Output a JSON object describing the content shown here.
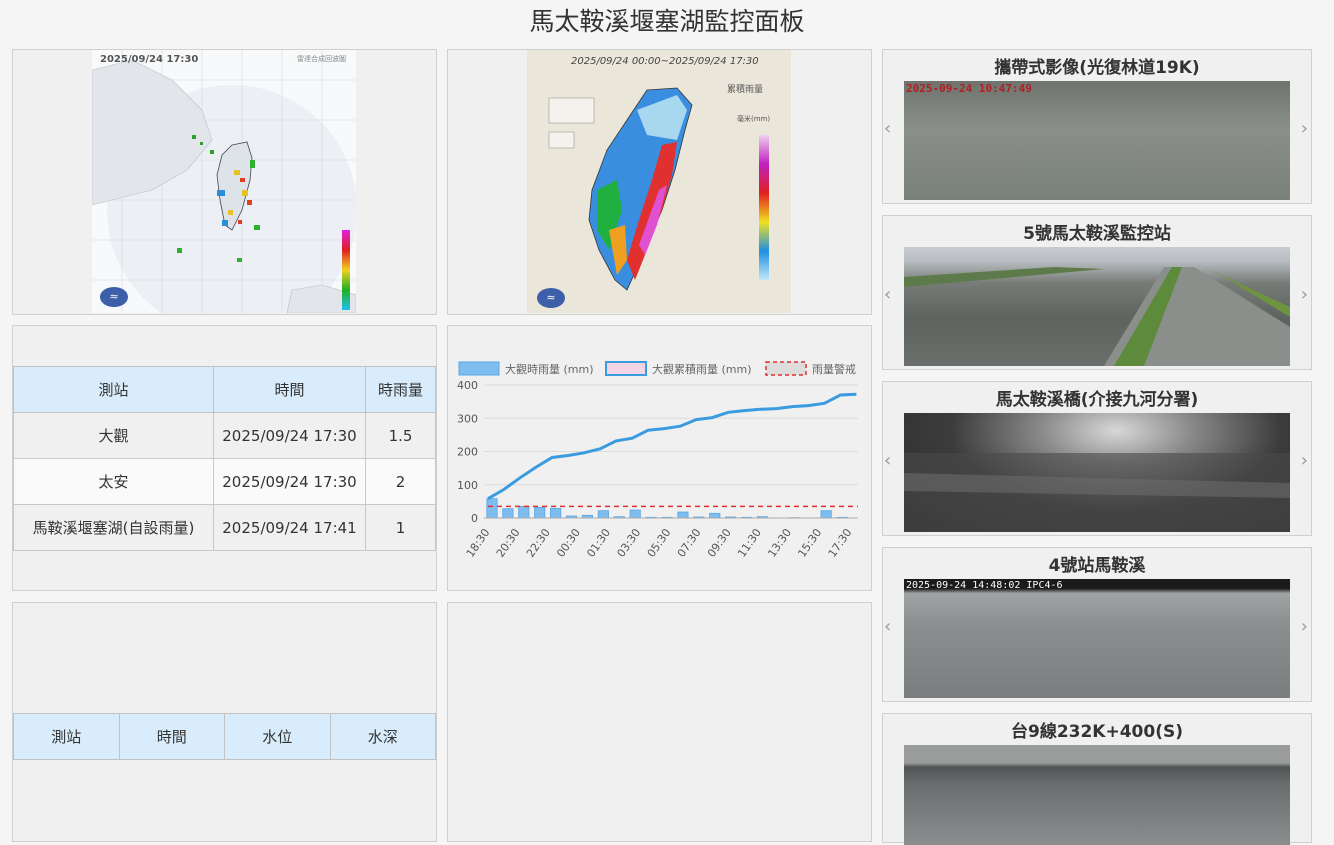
{
  "page": {
    "title": "馬太鞍溪堰塞湖監控面板"
  },
  "radar_image": {
    "timestamp": "2025/09/24  17:30",
    "caption": "雷達合成回波圖"
  },
  "accumulated_image": {
    "range": "2025/09/24 00:00~2025/09/24 17:30",
    "caption": "累積雨量",
    "unit": "毫米(mm)"
  },
  "rain_table": {
    "headers": [
      "測站",
      "時間",
      "時雨量"
    ],
    "rows": [
      {
        "station": "大觀",
        "time": "2025/09/24 17:30",
        "value": "1.5"
      },
      {
        "station": "太安",
        "time": "2025/09/24 17:30",
        "value": "2"
      },
      {
        "station": "馬鞍溪堰塞湖(自設雨量)",
        "time": "2025/09/24 17:41",
        "value": "1"
      }
    ]
  },
  "water_table": {
    "headers": [
      "測站",
      "時間",
      "水位",
      "水深"
    ]
  },
  "chart_data": {
    "type": "bar",
    "legend": [
      "大觀時雨量 (mm)",
      "大觀累積雨量 (mm)",
      "雨量警戒"
    ],
    "legend_position": "top",
    "ylim": [
      0,
      400
    ],
    "yticks": [
      "400",
      "300",
      "200",
      "100",
      "0"
    ],
    "xtick_labels": [
      "18:30",
      "20:30",
      "22:30",
      "00:30",
      "01:30",
      "03:30",
      "05:30",
      "07:30",
      "09:30",
      "11:30",
      "13:30",
      "15:30",
      "17:30"
    ],
    "grid": true,
    "hourly_bars": [
      58,
      28,
      35,
      32,
      29,
      6,
      8,
      22,
      4,
      24,
      2,
      2,
      18,
      3,
      14,
      3,
      2,
      4,
      0,
      1,
      0,
      22,
      2
    ],
    "cumulative_line": [
      58,
      86,
      121,
      153,
      182,
      188,
      196,
      208,
      232,
      240,
      264,
      269,
      276,
      296,
      302,
      318,
      323,
      327,
      329,
      335,
      338,
      345,
      370,
      372
    ],
    "warning_level": 35,
    "colors": {
      "bars": "#7dbdf0",
      "line": "#3a9be0",
      "warning": "#e03030"
    }
  },
  "cameras": [
    {
      "title": "攜帶式影像(光復林道19K)",
      "stamp": "2025-09-24  10:47:49",
      "stamp_color": "#b02020"
    },
    {
      "title": "5號馬太鞍溪監控站",
      "stamp": "",
      "stamp_color": "#ffffff"
    },
    {
      "title": "馬太鞍溪橋(介接九河分署)",
      "stamp": "",
      "stamp_color": "#ffffff"
    },
    {
      "title": "4號站馬鞍溪",
      "stamp": "2025-09-24 14:48:02 IPC4-6",
      "stamp_color": "#ffffff"
    },
    {
      "title": "台9線232K+400(S)",
      "stamp": "",
      "stamp_color": "#ffffff"
    }
  ],
  "nav": {
    "prev": "‹",
    "next": "›"
  }
}
